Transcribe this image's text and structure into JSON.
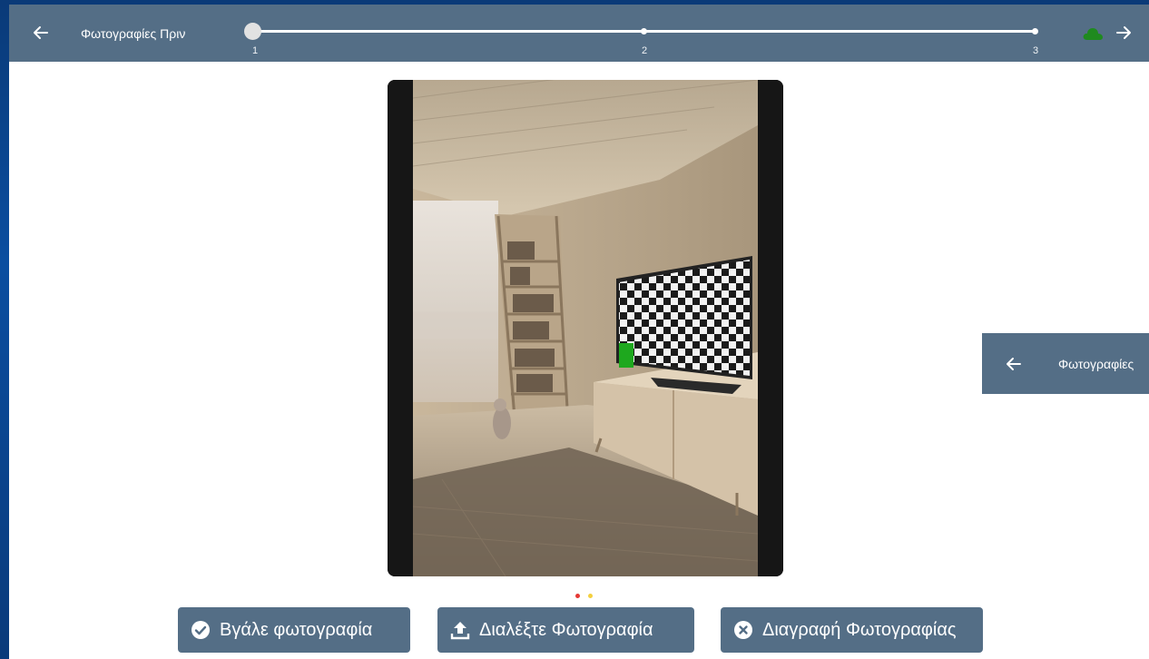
{
  "header": {
    "title": "Φωτογραφίες Πριν",
    "steps": [
      "1",
      "2",
      "3"
    ],
    "back_icon": "arrow-left-icon",
    "sync_icon": "cloud-icon",
    "sync_color": "#1f8a1f",
    "forward_icon": "arrow-right-icon"
  },
  "carousel": {
    "page_count": 2,
    "active_color": "#e53935",
    "inactive_color": "#f4d03f"
  },
  "actions": {
    "take_photo": "Βγάλε φωτογραφία",
    "choose_photo": "Διαλέξτε Φωτογραφία",
    "delete_photo": "Διαγραφή Φωτογραφίας"
  },
  "overlay_header": {
    "title": "Φωτογραφίες"
  },
  "colors": {
    "bar": "#546e86",
    "background": "#0b4ea0"
  }
}
